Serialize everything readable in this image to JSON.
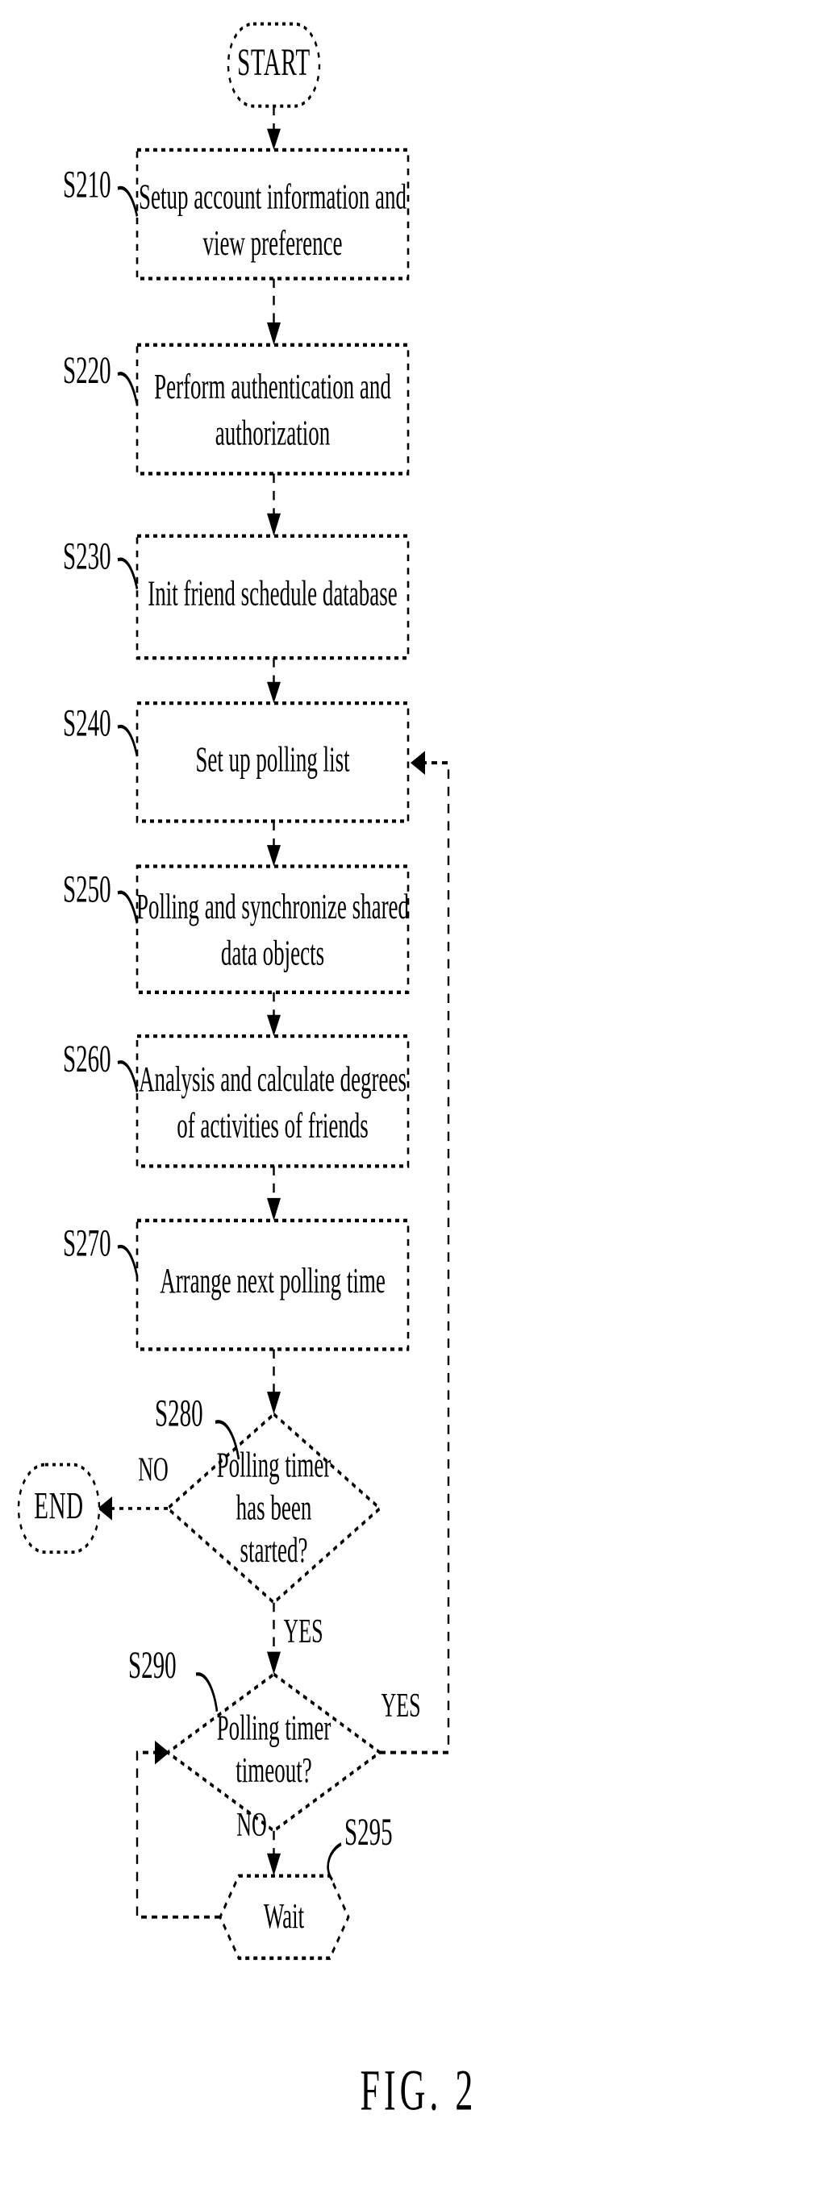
{
  "figure": {
    "caption": "FIG. 2",
    "type": "flowchart"
  },
  "terminators": {
    "start": "START",
    "end": "END"
  },
  "steps": [
    {
      "id": "S210",
      "label": "S210",
      "line1": "Setup account information and",
      "line2": "view preference"
    },
    {
      "id": "S220",
      "label": "S220",
      "line1": "Perform authentication and",
      "line2": "authorization"
    },
    {
      "id": "S230",
      "label": "S230",
      "line1": "Init friend schedule database",
      "line2": ""
    },
    {
      "id": "S240",
      "label": "S240",
      "line1": "Set up polling list",
      "line2": ""
    },
    {
      "id": "S250",
      "label": "S250",
      "line1": "Polling and synchronize shared",
      "line2": "data objects"
    },
    {
      "id": "S260",
      "label": "S260",
      "line1": "Analysis and calculate degrees",
      "line2": "of activities of friends"
    },
    {
      "id": "S270",
      "label": "S270",
      "line1": "Arrange next polling time",
      "line2": ""
    }
  ],
  "decisions": [
    {
      "id": "S280",
      "label": "S280",
      "line1": "Polling timer",
      "line2": "has been",
      "line3": "started?",
      "no_label": "NO",
      "yes_label": "YES"
    },
    {
      "id": "S290",
      "label": "S290",
      "line1": "Polling timer",
      "line2": "timeout?",
      "line3": "",
      "no_label": "NO",
      "yes_label": "YES"
    }
  ],
  "wait_node": {
    "id": "S295",
    "label": "S295",
    "text": "Wait"
  },
  "colors": {
    "stroke": "#000000",
    "fill": "#ffffff",
    "text": "#000000"
  }
}
